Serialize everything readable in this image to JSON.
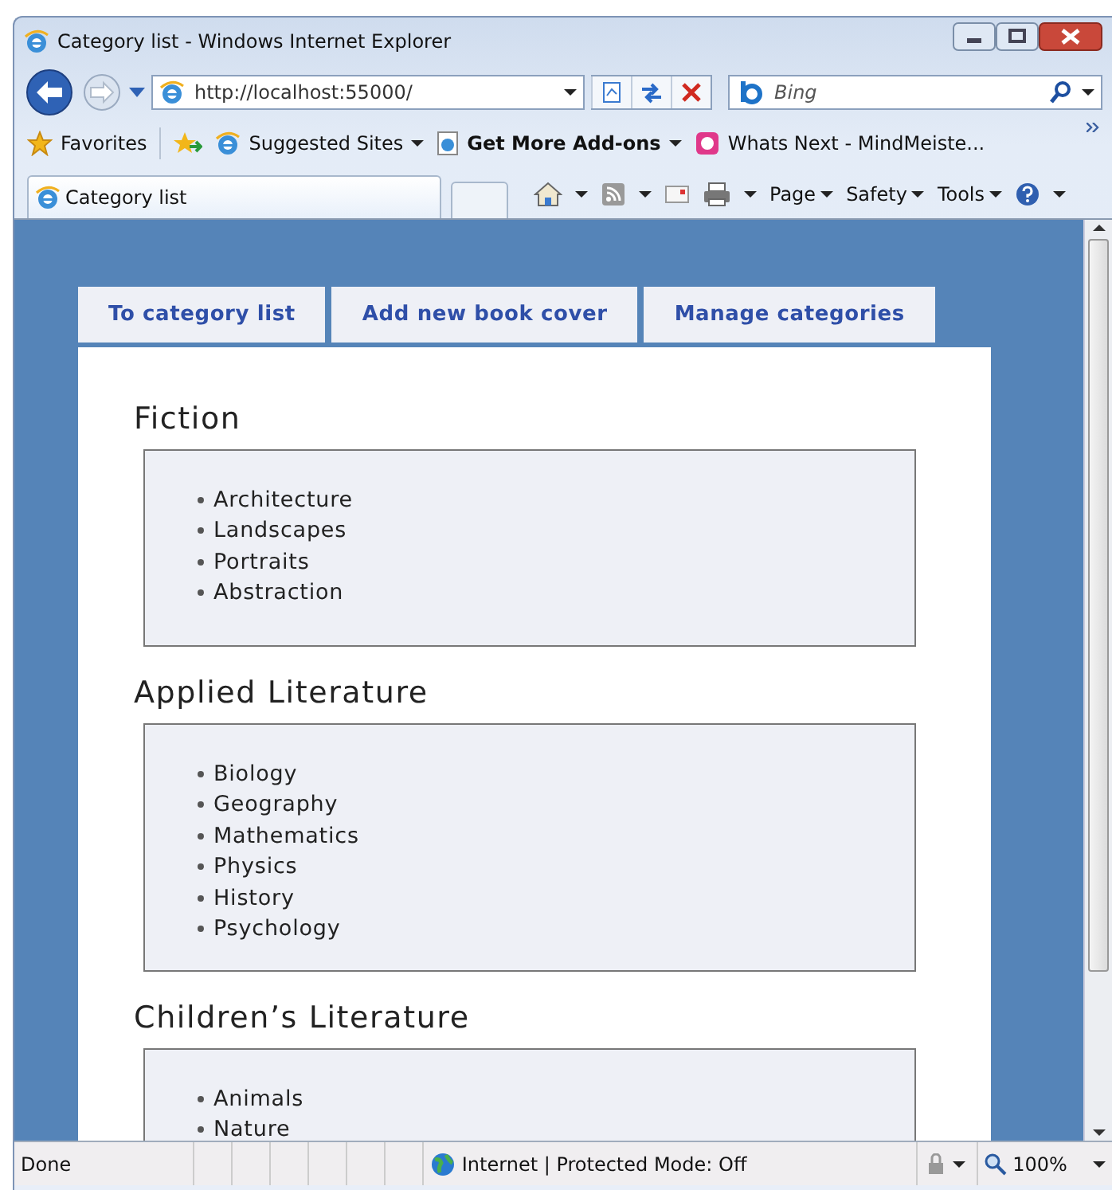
{
  "window": {
    "title": "Category list - Windows Internet Explorer"
  },
  "address_bar": {
    "value": "http://localhost:55000/"
  },
  "search": {
    "placeholder": "Bing"
  },
  "favorites_bar": {
    "favorites": "Favorites",
    "links": [
      {
        "label": "Suggested Sites",
        "kind": "ie",
        "menu": true
      },
      {
        "label": "Get More Add-ons",
        "kind": "addons",
        "menu": true
      },
      {
        "label": "Whats Next  - MindMeiste...",
        "kind": "mind",
        "menu": false
      }
    ]
  },
  "browser_tab": {
    "label": "Category list"
  },
  "command_bar": {
    "menus": [
      "Page",
      "Safety",
      "Tools"
    ]
  },
  "page_tabs": [
    {
      "label": "To category list"
    },
    {
      "label": "Add new book cover"
    },
    {
      "label": "Manage categories"
    }
  ],
  "sections": [
    {
      "title": "Fiction",
      "items": [
        "Architecture",
        "Landscapes",
        "Portraits",
        "Abstraction"
      ]
    },
    {
      "title": "Applied Literature",
      "items": [
        "Biology",
        "Geography",
        "Mathematics",
        "Physics",
        "History",
        "Psychology"
      ]
    },
    {
      "title": "Children’s Literature",
      "items": [
        "Animals",
        "Nature"
      ]
    }
  ],
  "status_bar": {
    "status": "Done",
    "zone": "Internet | Protected Mode: Off",
    "zoom": "100%"
  }
}
